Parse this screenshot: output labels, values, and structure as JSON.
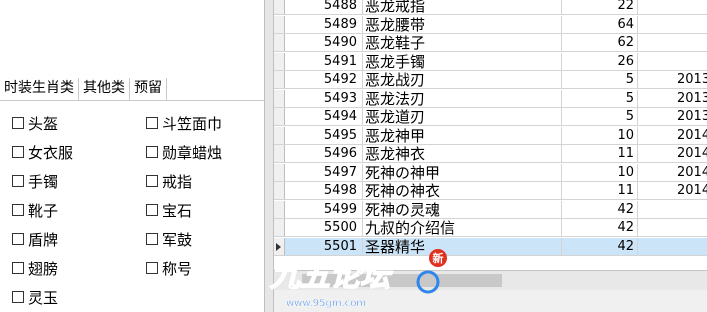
{
  "tabs": [
    {
      "label": "时装生肖类"
    },
    {
      "label": "其他类"
    },
    {
      "label": "预留"
    }
  ],
  "checkboxes_col1": [
    "头盔",
    "女衣服",
    "手镯",
    "靴子",
    "盾牌",
    "翅膀",
    "灵玉"
  ],
  "checkboxes_col2": [
    "斗笠面巾",
    "勋章蜡烛",
    "戒指",
    "宝石",
    "军鼓",
    "称号"
  ],
  "grid_rows": [
    {
      "id": "5488",
      "name": "恶龙戒指",
      "value": "22",
      "extra": ""
    },
    {
      "id": "5489",
      "name": "恶龙腰带",
      "value": "64",
      "extra": ""
    },
    {
      "id": "5490",
      "name": "恶龙鞋子",
      "value": "62",
      "extra": ""
    },
    {
      "id": "5491",
      "name": "恶龙手镯",
      "value": "26",
      "extra": ""
    },
    {
      "id": "5492",
      "name": "恶龙战刃",
      "value": "5",
      "extra": "2013"
    },
    {
      "id": "5493",
      "name": "恶龙法刃",
      "value": "5",
      "extra": "2013"
    },
    {
      "id": "5494",
      "name": "恶龙道刃",
      "value": "5",
      "extra": "2013"
    },
    {
      "id": "5495",
      "name": "恶龙神甲",
      "value": "10",
      "extra": "2014"
    },
    {
      "id": "5496",
      "name": "恶龙神衣",
      "value": "11",
      "extra": "2014"
    },
    {
      "id": "5497",
      "name": "死神の神甲",
      "value": "10",
      "extra": "2014"
    },
    {
      "id": "5498",
      "name": "死神の神衣",
      "value": "11",
      "extra": "2014"
    },
    {
      "id": "5499",
      "name": "死神の灵魂",
      "value": "42",
      "extra": ""
    },
    {
      "id": "5500",
      "name": "九叔的介绍信",
      "value": "42",
      "extra": ""
    },
    {
      "id": "5501",
      "name": "圣器精华",
      "value": "42",
      "extra": "",
      "selected": true
    }
  ],
  "watermark": {
    "logo_text": "九五论坛",
    "url_text": "www.95gm.com",
    "badge": "新"
  }
}
